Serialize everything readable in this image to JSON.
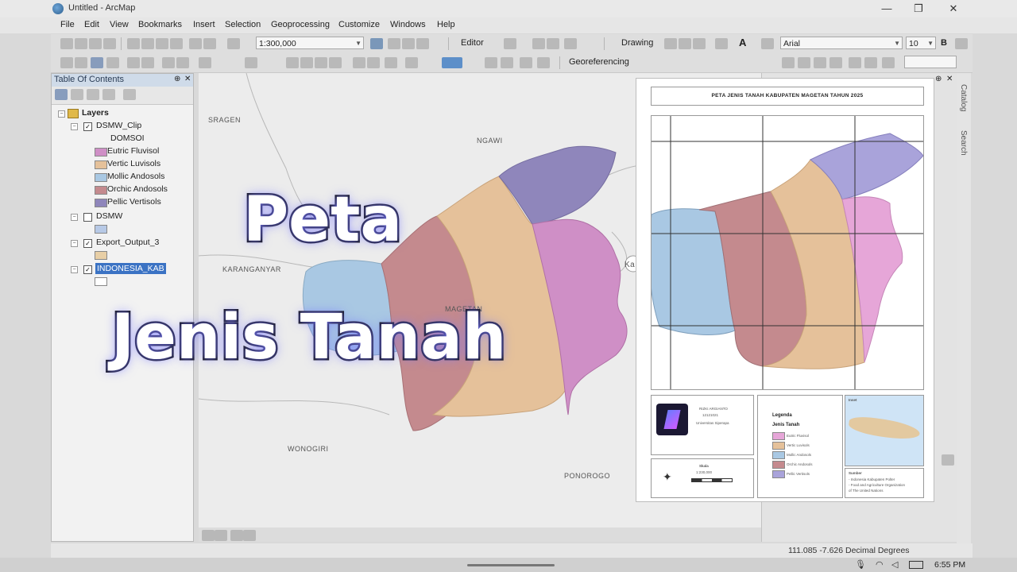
{
  "window": {
    "title": "Untitled - ArcMap",
    "minimize": "—",
    "maximize": "❐",
    "close": "✕"
  },
  "menu": [
    "File",
    "Edit",
    "View",
    "Bookmarks",
    "Insert",
    "Selection",
    "Geoprocessing",
    "Customize",
    "Windows",
    "Help"
  ],
  "toolbar": {
    "scale": "1:300,000",
    "editor": "Editor",
    "drawing": "Drawing",
    "text_tool": "A",
    "font": "Arial",
    "font_size": "10",
    "bold": "B",
    "georeferencing": "Georeferencing"
  },
  "toc": {
    "title": "Table Of Contents",
    "pin": "⊕",
    "close": "✕",
    "root": "Layers",
    "layers": [
      {
        "name": "DSMW_Clip",
        "checked": true,
        "field": "DOMSOI",
        "classes": [
          {
            "label": "Eutric Fluvisol",
            "color": "#cf8fc6"
          },
          {
            "label": "Vertic Luvisols",
            "color": "#e5c19a"
          },
          {
            "label": "Mollic Andosols",
            "color": "#a9c8e3"
          },
          {
            "label": "Orchic Andosols",
            "color": "#c48a8e"
          },
          {
            "label": "Pellic Vertisols",
            "color": "#8f86bb"
          }
        ]
      },
      {
        "name": "DSMW",
        "checked": false,
        "swatch": "#b7c9e6"
      },
      {
        "name": "Export_Output_3",
        "checked": true,
        "swatch": "#e8cfa6"
      },
      {
        "name": "INDONESIA_KAB",
        "checked": true,
        "selected": true,
        "swatch": "#ffffff"
      }
    ]
  },
  "map": {
    "places": [
      "SRAGEN",
      "NGAWI",
      "KARANGANYAR",
      "MAGETAN",
      "WONOGIRI",
      "PONOROGO"
    ],
    "edge_label": "Ka"
  },
  "right_tabs": [
    "Catalog",
    "Search"
  ],
  "layout_page": {
    "title": "PETA JENIS TANAH KABUPATEN MAGETAN TAHUN 2025",
    "legend_title": "Legenda",
    "legend_subtitle": "Jenis Tanah",
    "legend": [
      "Eutric Fluvisol",
      "Vertic Luvisols",
      "Mollic Andosols",
      "Orchic Andosols",
      "Pellic Vertisols"
    ],
    "author": "RIZKI ARGIANTO",
    "nim": "12121021",
    "university": "Universitas Siperapa",
    "scale_title": "Skala",
    "scale_value": "1:230,000",
    "inset_title": "Inset",
    "source_title": "Sumber",
    "sources": [
      "- Indonesia Kabupaten Polter",
      "- Food and Agriculture Organization",
      "  of The United Nations"
    ]
  },
  "overlay": {
    "line1": "Peta",
    "line2": "Jenis Tanah"
  },
  "status": {
    "coords": "111.085  -7.626 Decimal Degrees"
  },
  "taskbar": {
    "time": "6:55 PM"
  }
}
